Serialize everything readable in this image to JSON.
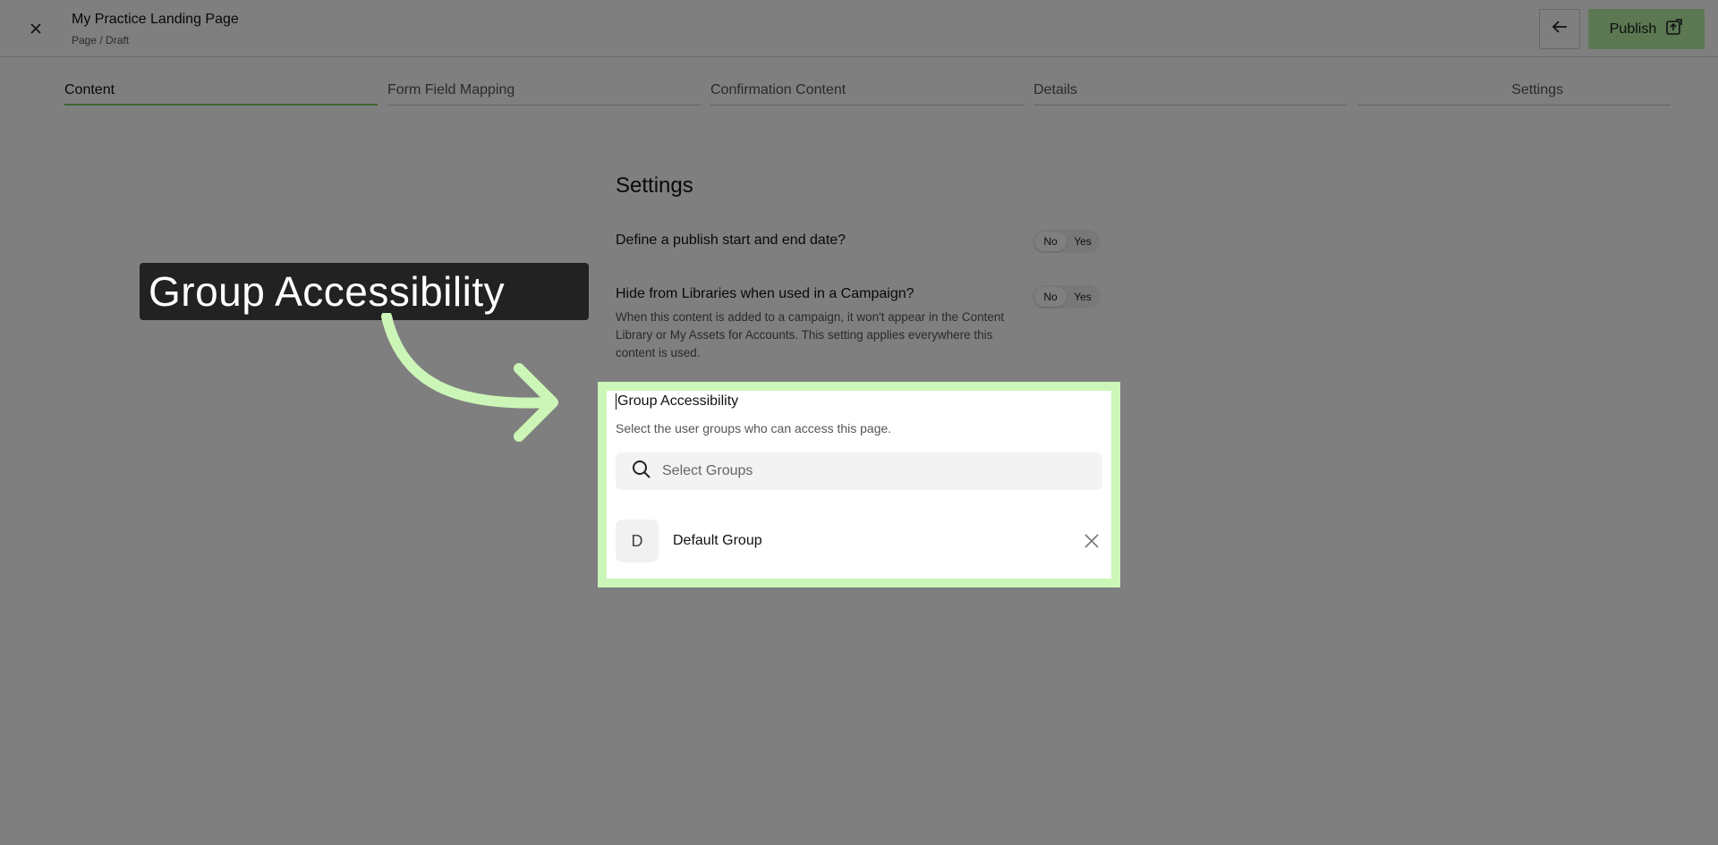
{
  "header": {
    "title": "My Practice Landing Page",
    "subtitle": "Page / Draft",
    "publish_label": "Publish"
  },
  "tabs": [
    {
      "label": "Content",
      "active": true
    },
    {
      "label": "Form Field Mapping",
      "active": false
    },
    {
      "label": "Confirmation Content",
      "active": false
    },
    {
      "label": "Details",
      "active": false
    },
    {
      "label": "Settings",
      "active": false
    }
  ],
  "settings": {
    "title": "Settings",
    "publish_dates": {
      "question": "Define a publish start and end date?",
      "no": "No",
      "yes": "Yes",
      "selected": "No"
    },
    "hide_libraries": {
      "question": "Hide from Libraries when used in a Campaign?",
      "help": "When this content is added to a campaign, it won't appear in the Content Library or My Assets for Accounts. This setting applies everywhere this content is used.",
      "no": "No",
      "yes": "Yes",
      "selected": "No"
    },
    "group_access": {
      "title": "Group Accessibility",
      "help": "Select the user groups who can access this page.",
      "search_placeholder": "Select Groups",
      "groups": [
        {
          "initial": "D",
          "name": "Default Group"
        }
      ]
    }
  },
  "callout": {
    "text": "Group Accessibility"
  },
  "colors": {
    "accent": "#b6f0a5",
    "highlight": "#ccf6b8",
    "tab_active": "#7ccf63",
    "callout_bg": "#222222"
  },
  "icons": {
    "close": "close-icon",
    "back": "arrow-left-icon",
    "publish": "publish-icon",
    "search": "search-icon",
    "remove": "close-icon"
  }
}
